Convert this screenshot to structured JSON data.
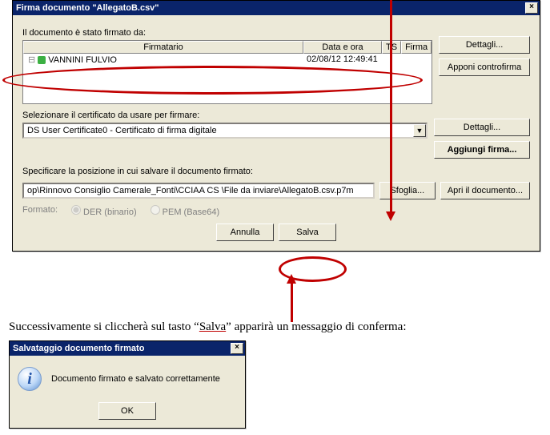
{
  "window": {
    "title": "Firma documento \"AllegatoB.csv\""
  },
  "section_signed": {
    "label": "Il documento è stato firmato da:",
    "columns": {
      "c1": "Firmatario",
      "c2": "Data e ora",
      "c3": "TS",
      "c4": "Firma"
    },
    "row": {
      "name": "VANNINI FULVIO",
      "datetime": "02/08/12 12:49:41"
    },
    "btn_details": "Dettagli...",
    "btn_counter": "Apponi controfirma"
  },
  "section_cert": {
    "label": "Selezionare il certificato da usare per firmare:",
    "selected": "DS User Certificate0 - Certificato di firma digitale",
    "btn_details": "Dettagli...",
    "btn_add": "Aggiungi firma..."
  },
  "section_save": {
    "label": "Specificare la posizione in cui salvare il documento firmato:",
    "path": "op\\Rinnovo Consiglio Camerale_Fonti\\CCIAA CS \\File  da inviare\\AllegatoB.csv.p7m",
    "btn_browse": "Sfoglia...",
    "btn_open": "Apri il documento...",
    "format_label": "Formato:",
    "radio_der": "DER (binario)",
    "radio_pem": "PEM (Base64)"
  },
  "bottom": {
    "cancel": "Annulla",
    "save": "Salva"
  },
  "caption": {
    "before": "Successivamente si cliccherà sul tasto “",
    "salva": "Salva",
    "after": "” apparirà un messaggio di conferma:"
  },
  "confirm": {
    "title": "Salvataggio documento firmato",
    "msg": "Documento firmato e salvato correttamente",
    "ok": "OK"
  }
}
